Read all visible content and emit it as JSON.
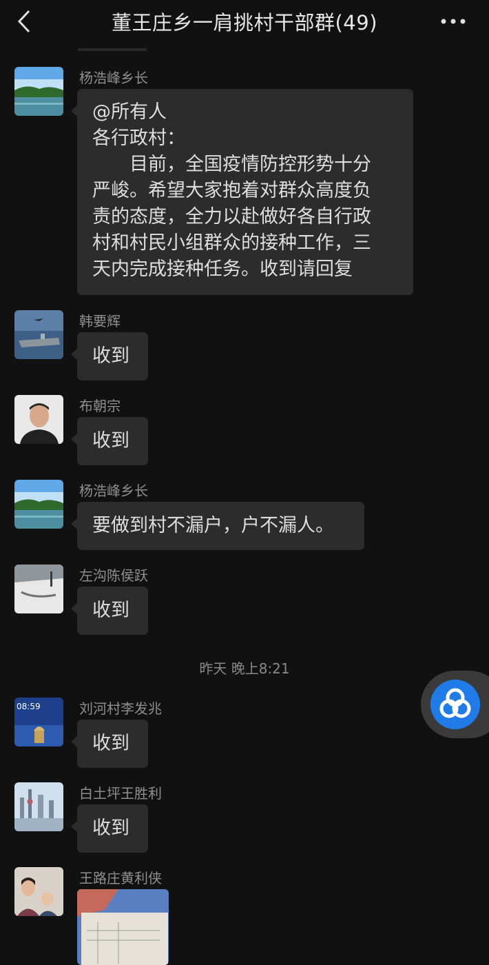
{
  "header": {
    "title": "董王庄乡一肩挑村干部群(49)",
    "back_icon": "chevron-left-icon",
    "more_icon": "more-dots-icon"
  },
  "messages": [
    {
      "sender": "杨浩峰乡长",
      "avatar": "lake-landscape-avatar",
      "lines": [
        "@所有人",
        "各行政村：",
        "目前，全国疫情防控形势十分",
        "严峻。希望大家抱着对群众高度负",
        "责的态度，全力以赴做好各自行政",
        "村和村民小组群众的接种工作，三",
        "天内完成接种任务。收到请回复"
      ]
    },
    {
      "sender": "韩要辉",
      "avatar": "aircraft-carrier-avatar",
      "text": "收到"
    },
    {
      "sender": "布朝宗",
      "avatar": "man-portrait-avatar",
      "text": "收到"
    },
    {
      "sender": "杨浩峰乡长",
      "avatar": "lake-landscape-avatar",
      "text": "要做到村不漏户，户不漏人。"
    },
    {
      "sender": "左沟陈侯跃",
      "avatar": "snowy-street-avatar",
      "text": "收到"
    },
    {
      "sender": "刘河村李发兆",
      "avatar": "phone-lockscreen-avatar",
      "avatar_time": "08:59",
      "text": "收到"
    },
    {
      "sender": "白土坪王胜利",
      "avatar": "city-skyline-avatar",
      "text": "收到"
    },
    {
      "sender": "王路庄黄利侠",
      "avatar": "family-photo-avatar",
      "image": "document-photo-image"
    }
  ],
  "timestamp": "昨天 晚上8:21",
  "float_button": {
    "icon": "assistant-logo-icon"
  },
  "colors": {
    "background": "#111111",
    "bubble": "#2c2c2c",
    "accent": "#1f7be8"
  }
}
